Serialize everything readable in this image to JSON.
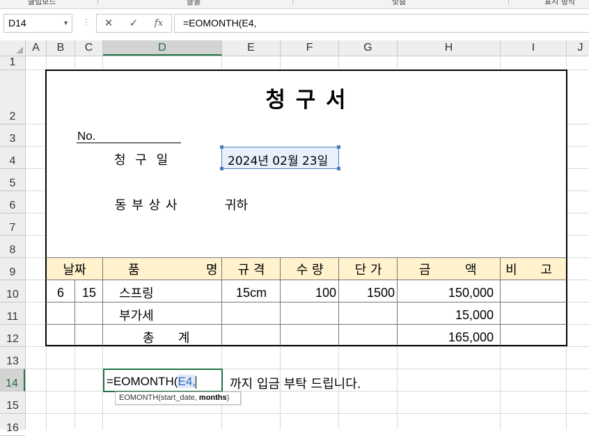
{
  "ribbon": {
    "groups": [
      "클립보드",
      "글꼴",
      "맞춤",
      "표시 형식"
    ]
  },
  "formula_bar": {
    "name_box": "D14",
    "cancel_icon": "✕",
    "enter_icon": "✓",
    "fx_icon": "fx",
    "formula": "=EOMONTH(E4,"
  },
  "columns": [
    "A",
    "B",
    "C",
    "D",
    "E",
    "F",
    "G",
    "H",
    "I",
    "J"
  ],
  "rows": [
    "1",
    "2",
    "3",
    "4",
    "5",
    "6",
    "7",
    "8",
    "9",
    "10",
    "11",
    "12",
    "13",
    "14",
    "15",
    "16"
  ],
  "selected_column": "D",
  "selected_row": "14",
  "invoice": {
    "title": "청 구 서",
    "no_label": "No.",
    "request_date_label": "청 구 일",
    "request_date_value": "2024년 02월 23일",
    "company": "동 부 상 사",
    "honorific": "귀하",
    "headers": {
      "date": "날짜",
      "item_a": "품",
      "item_b": "명",
      "spec": "규 격",
      "qty": "수 량",
      "unit_price": "단 가",
      "amount_a": "금",
      "amount_b": "액",
      "note": "비 고"
    },
    "rows": [
      {
        "month": "6",
        "day": "15",
        "item": "스프링",
        "spec": "15cm",
        "qty": "100",
        "unit_price": "1500",
        "amount": "150,000"
      },
      {
        "item": "부가세",
        "amount": "15,000"
      },
      {
        "item": "총      계",
        "amount": "165,000"
      }
    ]
  },
  "editing": {
    "cell_prefix": "=EOMONTH(",
    "cell_ref": "E4,",
    "trailing_text": "까지 입금 부탁 드립니다.",
    "tooltip_func": "EOMONTH(start_date, ",
    "tooltip_arg": "months",
    "tooltip_end": ")"
  },
  "colors": {
    "accent": "#217346",
    "header_fill": "#fff2cc",
    "ref_blue": "#4a7ebb"
  }
}
